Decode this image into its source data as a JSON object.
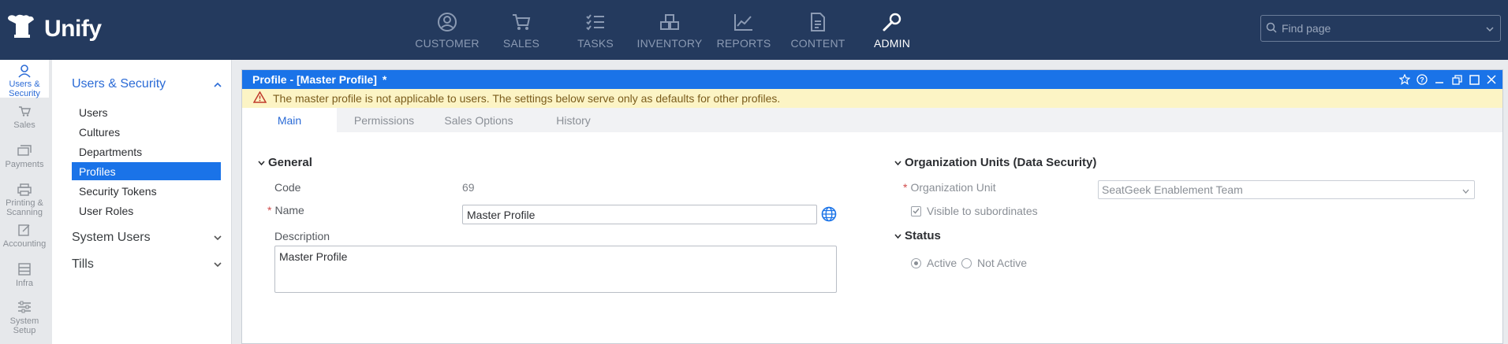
{
  "app": {
    "brand": "Unify"
  },
  "topnav": {
    "items": [
      {
        "label": "CUSTOMER",
        "icon": "customer-icon"
      },
      {
        "label": "SALES",
        "icon": "cart-icon"
      },
      {
        "label": "TASKS",
        "icon": "tasks-icon"
      },
      {
        "label": "INVENTORY",
        "icon": "inventory-icon"
      },
      {
        "label": "REPORTS",
        "icon": "reports-icon"
      },
      {
        "label": "CONTENT",
        "icon": "content-icon"
      },
      {
        "label": "ADMIN",
        "icon": "wrench-icon",
        "active": true
      }
    ],
    "search_placeholder": "Find page"
  },
  "rail": {
    "items": [
      {
        "label": "Users & Security",
        "icon": "user-icon",
        "active": true
      },
      {
        "label": "Sales",
        "icon": "cart-icon"
      },
      {
        "label": "Payments",
        "icon": "payments-icon"
      },
      {
        "label": "Printing & Scanning",
        "icon": "printer-icon"
      },
      {
        "label": "Accounting",
        "icon": "accounting-icon"
      },
      {
        "label": "Infra",
        "icon": "infra-icon"
      },
      {
        "label": "System Setup",
        "icon": "sliders-icon"
      }
    ]
  },
  "submenu": {
    "sections": [
      {
        "label": "Users & Security",
        "expanded": true
      },
      {
        "label": "System Users",
        "expanded": false
      },
      {
        "label": "Tills",
        "expanded": false
      }
    ],
    "links": [
      {
        "label": "Users"
      },
      {
        "label": "Cultures"
      },
      {
        "label": "Departments"
      },
      {
        "label": "Profiles",
        "active": true
      },
      {
        "label": "Security Tokens"
      },
      {
        "label": "User Roles"
      }
    ]
  },
  "window": {
    "title": "Profile - [Master Profile]",
    "modified_marker": "*",
    "warning": "The master profile is not applicable to users. The settings below serve only as defaults for other profiles.",
    "tabs": [
      {
        "label": "Main",
        "active": true
      },
      {
        "label": "Permissions"
      },
      {
        "label": "Sales Options"
      },
      {
        "label": "History"
      }
    ]
  },
  "form": {
    "general": {
      "heading": "General",
      "code_label": "Code",
      "code_value": "69",
      "name_label": "Name",
      "name_value": "Master Profile",
      "description_label": "Description",
      "description_value": "Master Profile"
    },
    "org_units": {
      "heading": "Organization Units (Data Security)",
      "org_unit_label": "Organization Unit",
      "org_unit_value": "SeatGeek Enablement Team",
      "visible_label": "Visible to subordinates",
      "visible_checked": true
    },
    "status": {
      "heading": "Status",
      "active_label": "Active",
      "not_active_label": "Not Active",
      "selected": "Active"
    }
  },
  "colors": {
    "topbar": "#243a5e",
    "accent": "#1a73e8",
    "warning_bg": "#fcf4c5",
    "warning_icon": "#c0392b"
  }
}
